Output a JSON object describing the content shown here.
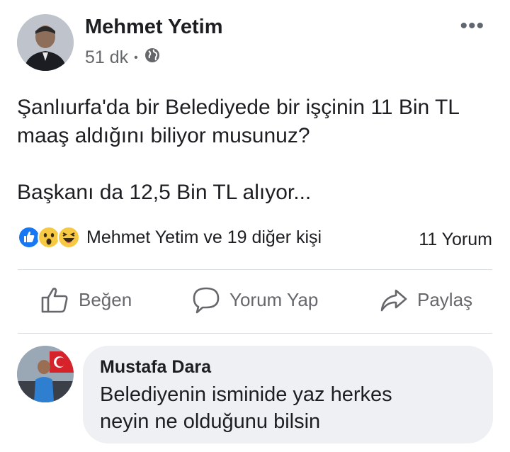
{
  "post": {
    "author": "Mehmet Yetim",
    "time": "51 dk",
    "separator": "•",
    "privacy_icon": "globe-icon",
    "more_label": "•••",
    "text": "Şanlıurfa'da bir Belediyede bir işçinin 11 Bin TL\nmaaş aldığını biliyor musunuz?\n\nBaşkanı da 12,5 Bin TL alıyor..."
  },
  "reactions": {
    "icons": [
      "like-icon",
      "wow-icon",
      "haha-icon"
    ],
    "summary": "Mehmet Yetim ve 19 diğer kişi",
    "comment_count": "11 Yorum"
  },
  "actions": {
    "like_label": "Beğen",
    "comment_label": "Yorum Yap",
    "share_label": "Paylaş"
  },
  "comment": {
    "author": "Mustafa Dara",
    "text": "Belediyenin isminide yaz herkes\nneyin ne olduğunu bilsin"
  },
  "colors": {
    "like_blue": "#1877f2",
    "emoji_yellow": "#f7c942",
    "secondary_text": "#65676b",
    "bubble_bg": "#eef0f3"
  }
}
